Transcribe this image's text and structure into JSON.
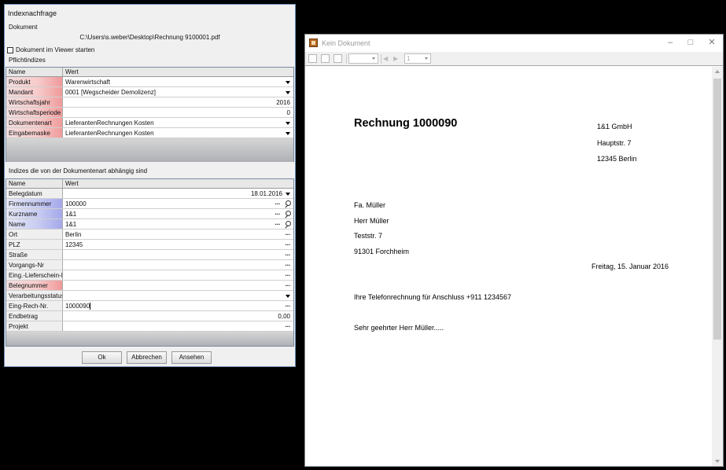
{
  "dialog": {
    "title": "Indexnachfrage",
    "document_section": "Dokument",
    "document_path": "C:\\Users\\s.weber\\Desktop\\Rechnung 9100001.pdf",
    "viewer_checkbox_label": "Dokument im Viewer starten",
    "viewer_checkbox_checked": false,
    "mandatory_section": "Pflichtindizes",
    "dependent_section": "Indizes die von der Dokumentenart abhängig sind",
    "col_name": "Name",
    "col_value": "Wert",
    "mandatory_rows": [
      {
        "name": "Produkt",
        "value": "Warenwirtschaft",
        "style": "req",
        "align": "left",
        "control": "dropdown"
      },
      {
        "name": "Mandant",
        "value": "0001 [Wegscheider Demolizenz]",
        "style": "req",
        "align": "left",
        "control": "dropdown"
      },
      {
        "name": "Wirtschaftsjahr",
        "value": "2016",
        "style": "req",
        "align": "right",
        "control": "none"
      },
      {
        "name": "Wirtschaftsperiode",
        "value": "0",
        "style": "req",
        "align": "right",
        "control": "none"
      },
      {
        "name": "Dokumentenart",
        "value": "LieferantenRechnungen Kosten",
        "style": "req",
        "align": "left",
        "control": "dropdown"
      },
      {
        "name": "Eingabemaske",
        "value": "LieferantenRechnungen Kosten",
        "style": "req",
        "align": "left",
        "control": "dropdown"
      }
    ],
    "dependent_rows": [
      {
        "name": "Belegdatum",
        "value": "18.01.2016",
        "style": "plain",
        "align": "right",
        "control": "dropdown"
      },
      {
        "name": "Firmennummer",
        "value": "100000",
        "style": "blue",
        "align": "left",
        "control": "lookup"
      },
      {
        "name": "Kurzname",
        "value": "1&1",
        "style": "blue",
        "align": "left",
        "control": "lookup"
      },
      {
        "name": "Name",
        "value": "1&1",
        "style": "blue",
        "align": "left",
        "control": "lookup"
      },
      {
        "name": "Ort",
        "value": "Berlin",
        "style": "plain",
        "align": "left",
        "control": "ellipsis"
      },
      {
        "name": "PLZ",
        "value": "12345",
        "style": "plain",
        "align": "left",
        "control": "ellipsis"
      },
      {
        "name": "Straße",
        "value": "",
        "style": "plain",
        "align": "left",
        "control": "ellipsis"
      },
      {
        "name": "Vorgangs-Nr",
        "value": "",
        "style": "plain",
        "align": "left",
        "control": "ellipsis"
      },
      {
        "name": "Eing.-Lieferschein-N",
        "value": "",
        "style": "plain",
        "align": "left",
        "control": "ellipsis"
      },
      {
        "name": "Belegnummer",
        "value": "",
        "style": "req",
        "align": "left",
        "control": "ellipsis"
      },
      {
        "name": "Verarbeitungsstatus",
        "value": "",
        "style": "plain",
        "align": "left",
        "control": "dropdown"
      },
      {
        "name": "Eing-Rech-Nr.",
        "value": "1000090",
        "style": "plain",
        "align": "left",
        "control": "ellipsis",
        "editing": true
      },
      {
        "name": "Endbetrag",
        "value": "0,00",
        "style": "plain",
        "align": "right",
        "control": "none"
      },
      {
        "name": "Projekt",
        "value": "",
        "style": "plain",
        "align": "left",
        "control": "ellipsis"
      }
    ],
    "buttons": {
      "ok": "Ok",
      "cancel": "Abbrechen",
      "view": "Ansehen"
    }
  },
  "viewer": {
    "title": "Kein Dokument",
    "page_selector": "1",
    "document": {
      "heading": "Rechnung 1000090",
      "sender_name": "1&1 GmbH",
      "sender_street": "Hauptstr. 7",
      "sender_city": "12345 Berlin",
      "recipient_company": "Fa. Müller",
      "recipient_person": "Herr Müller",
      "recipient_street": "Teststr. 7",
      "recipient_city": "91301 Forchheim",
      "date": "Freitag, 15. Januar 2016",
      "subject": "Ihre Telefonrechnung für Anschluss +911 1234567",
      "salutation": "Sehr geehrter Herr Müller....."
    }
  }
}
